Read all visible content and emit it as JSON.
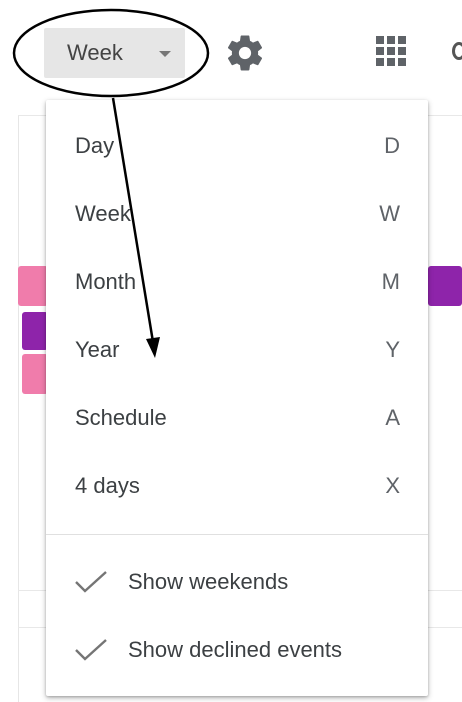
{
  "toolbar": {
    "view_select_label": "Week",
    "settings_icon": "gear-icon",
    "apps_icon": "apps-grid-icon"
  },
  "view_menu": {
    "items": [
      {
        "label": "Day",
        "shortcut": "D"
      },
      {
        "label": "Week",
        "shortcut": "W"
      },
      {
        "label": "Month",
        "shortcut": "M"
      },
      {
        "label": "Year",
        "shortcut": "Y"
      },
      {
        "label": "Schedule",
        "shortcut": "A"
      },
      {
        "label": "4 days",
        "shortcut": "X"
      }
    ],
    "options": [
      {
        "label": "Show weekends",
        "checked": true
      },
      {
        "label": "Show declined events",
        "checked": true
      }
    ]
  },
  "colors": {
    "pink_event": "#f07cab",
    "purple_event": "#8e24aa",
    "view_select_bg": "#e6e6e6"
  }
}
